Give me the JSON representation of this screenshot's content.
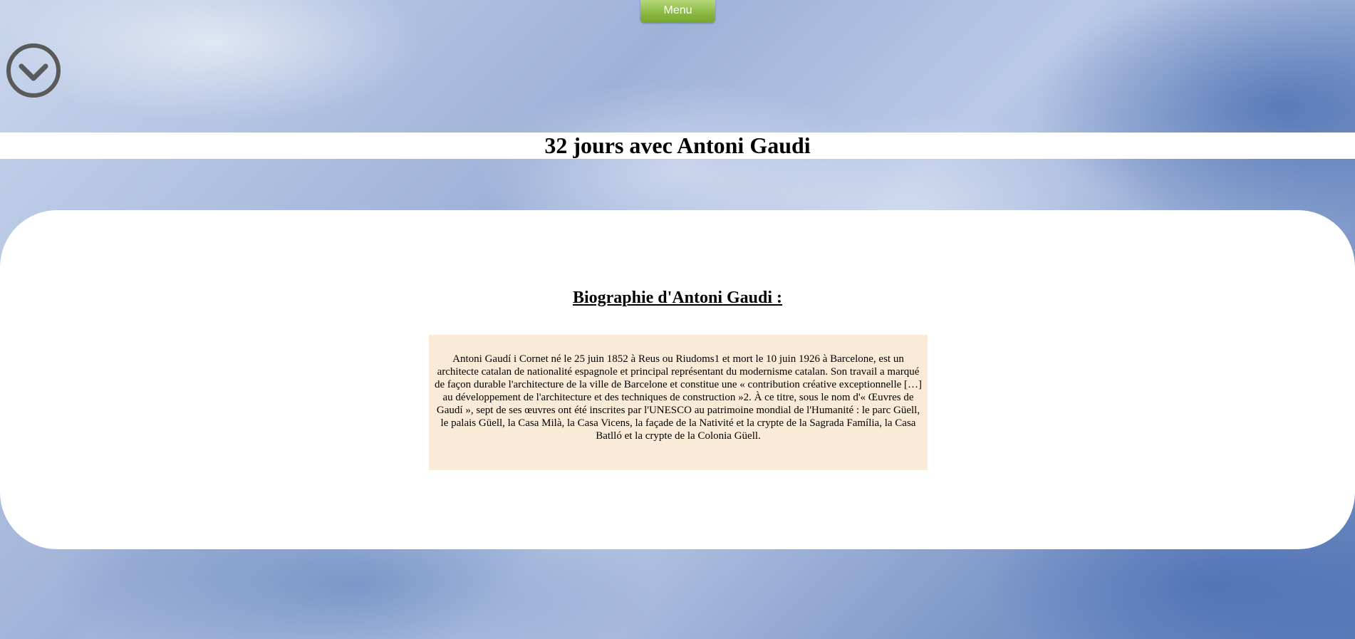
{
  "nav": {
    "menu_label": "Menu"
  },
  "icons": {
    "scroll_down": "chevron-down-circle-icon"
  },
  "header": {
    "title": "32 jours avec Antoni Gaudi"
  },
  "main": {
    "heading": "Biographie d'Antoni Gaudi :",
    "biography": "Antoni Gaudí i Cornet né le 25 juin 1852 à Reus ou Riudoms1 et mort le 10 juin 1926 à Barcelone, est un architecte catalan de nationalité espagnole et principal représentant du modernisme catalan. Son travail a marqué de façon durable l'architecture de la ville de Barcelone et constitue une « contribution créative exceptionnelle […] au développement de l'architecture et des techniques de construction »2. À ce titre, sous le nom d'« Œuvres de Gaudí », sept de ses œuvres ont été inscrites par l'UNESCO au patrimoine mondial de l'Humanité : le parc Güell, le palais Güell, la Casa Milà, la Casa Vicens, la façade de la Nativité et la crypte de la Sagrada Família, la Casa Batlló et la crypte de la Colonia Güell."
  },
  "colors": {
    "menu_green": "#8cba42",
    "bio_background": "#faebd9",
    "icon_gray": "#5a5a5a"
  }
}
